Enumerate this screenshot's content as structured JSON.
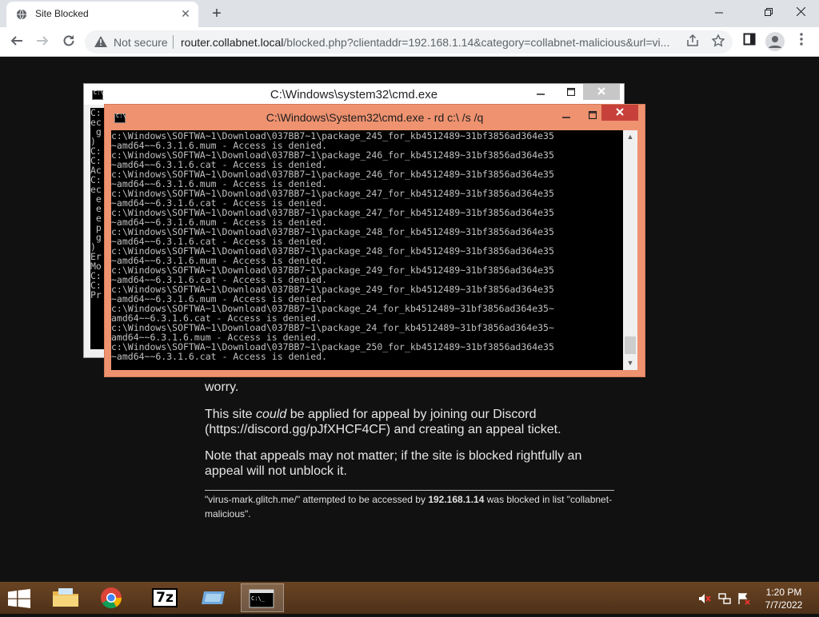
{
  "browser": {
    "tab_title": "Site Blocked",
    "tab_close_glyph": "✕",
    "new_tab_glyph": "+",
    "not_secure": "Not secure",
    "url_host": "router.collabnet.local",
    "url_path": "/blocked.php?clientaddr=192.168.1.14&category=collabnet-malicious&url=vi...",
    "icons": [
      "globe-icon",
      "back-icon",
      "forward-icon",
      "reload-icon",
      "warning-icon",
      "share-icon",
      "star-icon",
      "sidepanel-icon",
      "profile-icon",
      "menu-icon"
    ]
  },
  "page": {
    "p1": "worry.",
    "p2_before": "This site ",
    "p2_em": "could",
    "p2_after": " be applied for appeal by joining our Discord (https://discord.gg/pJfXHCF4CF) and creating an appeal ticket.",
    "p3": "Note that appeals may not matter; if the site is blocked rightfully an appeal will not unblock it.",
    "foot_a": "\"virus-mark.glitch.me/\" attempted to be accessed by ",
    "foot_ip": "192.168.1.14",
    "foot_b": " was blocked in list \"collabnet-malicious\"."
  },
  "cmd_back": {
    "title": "C:\\Windows\\system32\\cmd.exe",
    "left_chars": [
      "C:",
      "ec",
      " g",
      ")",
      "",
      "C:",
      "",
      "",
      "C:",
      "Ac",
      "",
      "C:",
      "ec",
      " e",
      " e",
      " e",
      " p",
      " g",
      ")",
      "Er",
      "Mo",
      "C:",
      "C:",
      "Pr"
    ]
  },
  "cmd_front": {
    "title": "C:\\Windows\\System32\\cmd.exe - rd  c:\\ /s /q",
    "lines": [
      "c:\\Windows\\SOFTWA~1\\Download\\037BB7~1\\package_245_for_kb4512489~31bf3856ad364e35",
      "~amd64~~6.3.1.6.mum - Access is denied.",
      "c:\\Windows\\SOFTWA~1\\Download\\037BB7~1\\package_246_for_kb4512489~31bf3856ad364e35",
      "~amd64~~6.3.1.6.cat - Access is denied.",
      "c:\\Windows\\SOFTWA~1\\Download\\037BB7~1\\package_246_for_kb4512489~31bf3856ad364e35",
      "~amd64~~6.3.1.6.mum - Access is denied.",
      "c:\\Windows\\SOFTWA~1\\Download\\037BB7~1\\package_247_for_kb4512489~31bf3856ad364e35",
      "~amd64~~6.3.1.6.cat - Access is denied.",
      "c:\\Windows\\SOFTWA~1\\Download\\037BB7~1\\package_247_for_kb4512489~31bf3856ad364e35",
      "~amd64~~6.3.1.6.mum - Access is denied.",
      "c:\\Windows\\SOFTWA~1\\Download\\037BB7~1\\package_248_for_kb4512489~31bf3856ad364e35",
      "~amd64~~6.3.1.6.cat - Access is denied.",
      "c:\\Windows\\SOFTWA~1\\Download\\037BB7~1\\package_248_for_kb4512489~31bf3856ad364e35",
      "~amd64~~6.3.1.6.mum - Access is denied.",
      "c:\\Windows\\SOFTWA~1\\Download\\037BB7~1\\package_249_for_kb4512489~31bf3856ad364e35",
      "~amd64~~6.3.1.6.cat - Access is denied.",
      "c:\\Windows\\SOFTWA~1\\Download\\037BB7~1\\package_249_for_kb4512489~31bf3856ad364e35",
      "~amd64~~6.3.1.6.mum - Access is denied.",
      "c:\\Windows\\SOFTWA~1\\Download\\037BB7~1\\package_24_for_kb4512489~31bf3856ad364e35~",
      "amd64~~6.3.1.6.cat - Access is denied.",
      "c:\\Windows\\SOFTWA~1\\Download\\037BB7~1\\package_24_for_kb4512489~31bf3856ad364e35~",
      "amd64~~6.3.1.6.mum - Access is denied.",
      "c:\\Windows\\SOFTWA~1\\Download\\037BB7~1\\package_250_for_kb4512489~31bf3856ad364e35",
      "~amd64~~6.3.1.6.cat - Access is denied."
    ]
  },
  "taskbar": {
    "apps": [
      "file-explorer",
      "chrome",
      "7-zip",
      "control-panel",
      "command-prompt"
    ],
    "sevenzip_label": "7z",
    "time": "1:20 PM",
    "date": "7/7/2022"
  }
}
